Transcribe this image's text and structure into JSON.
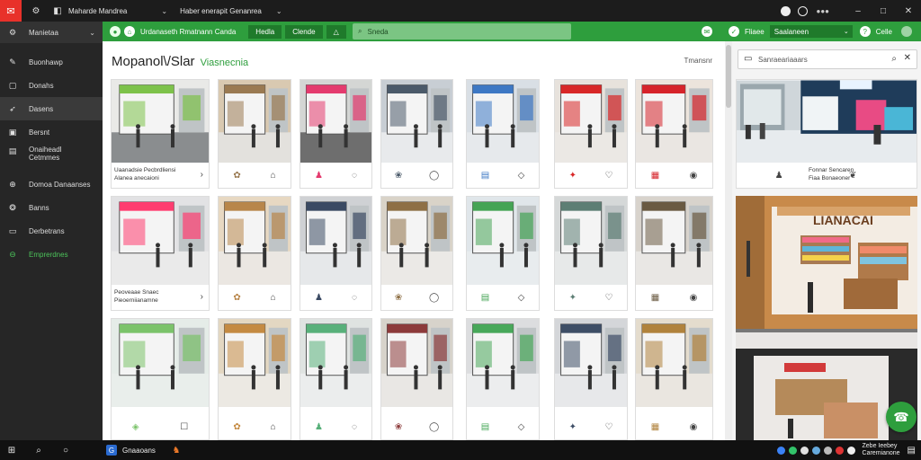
{
  "titlebar": {
    "tab1": "Maharde Mandrea",
    "tab2": "Haber enerapit Genanrea"
  },
  "sidebar": {
    "items": [
      {
        "label": "Manietaa",
        "icon": "gear-icon"
      },
      {
        "label": "Buonhawp",
        "icon": "pencil-icon"
      },
      {
        "label": "Donahs",
        "icon": "page-icon"
      },
      {
        "label": "Dasens",
        "icon": "bird-icon"
      },
      {
        "label": "Bersnt",
        "icon": "page-icon"
      },
      {
        "label": "Onaiheadl Cetmmes",
        "icon": "page-icon"
      },
      {
        "label": "Domoa Danaanses",
        "icon": "globe-icon"
      },
      {
        "label": "Banns",
        "icon": "globe-icon"
      },
      {
        "label": "Derbetrans",
        "icon": "window-icon"
      },
      {
        "label": "Emprerdnes",
        "icon": "circle-icon"
      }
    ]
  },
  "toolbar": {
    "brand": "Urdanaseth Rmatnann Canda",
    "btn1": "Hedla",
    "btn2": "Clende",
    "search_placeholder": "Sneda",
    "right_label": "Fliaee",
    "select_value": "Saalaneen",
    "right_label2": "Celle"
  },
  "main": {
    "title": "Mopanol\\/Slar",
    "subtitle": "Viasnecnia",
    "count": "Tmansnr",
    "captions": [
      "Uaanadsie Pecbrdliensi",
      "Alanea anecaioni"
    ],
    "captions2": [
      "Peoveaae Snaec",
      "Pieoerniianamne"
    ]
  },
  "right": {
    "search_placeholder": "Sanraeariaaars",
    "caption": "Fonnar Sencaren",
    "caption2": "Fiaa Bonaeoner",
    "sign": "LIANACAI"
  },
  "taskbar": {
    "app": "Gnaaoans",
    "time": "Zebe Ieebey",
    "date": "Caremianone"
  }
}
